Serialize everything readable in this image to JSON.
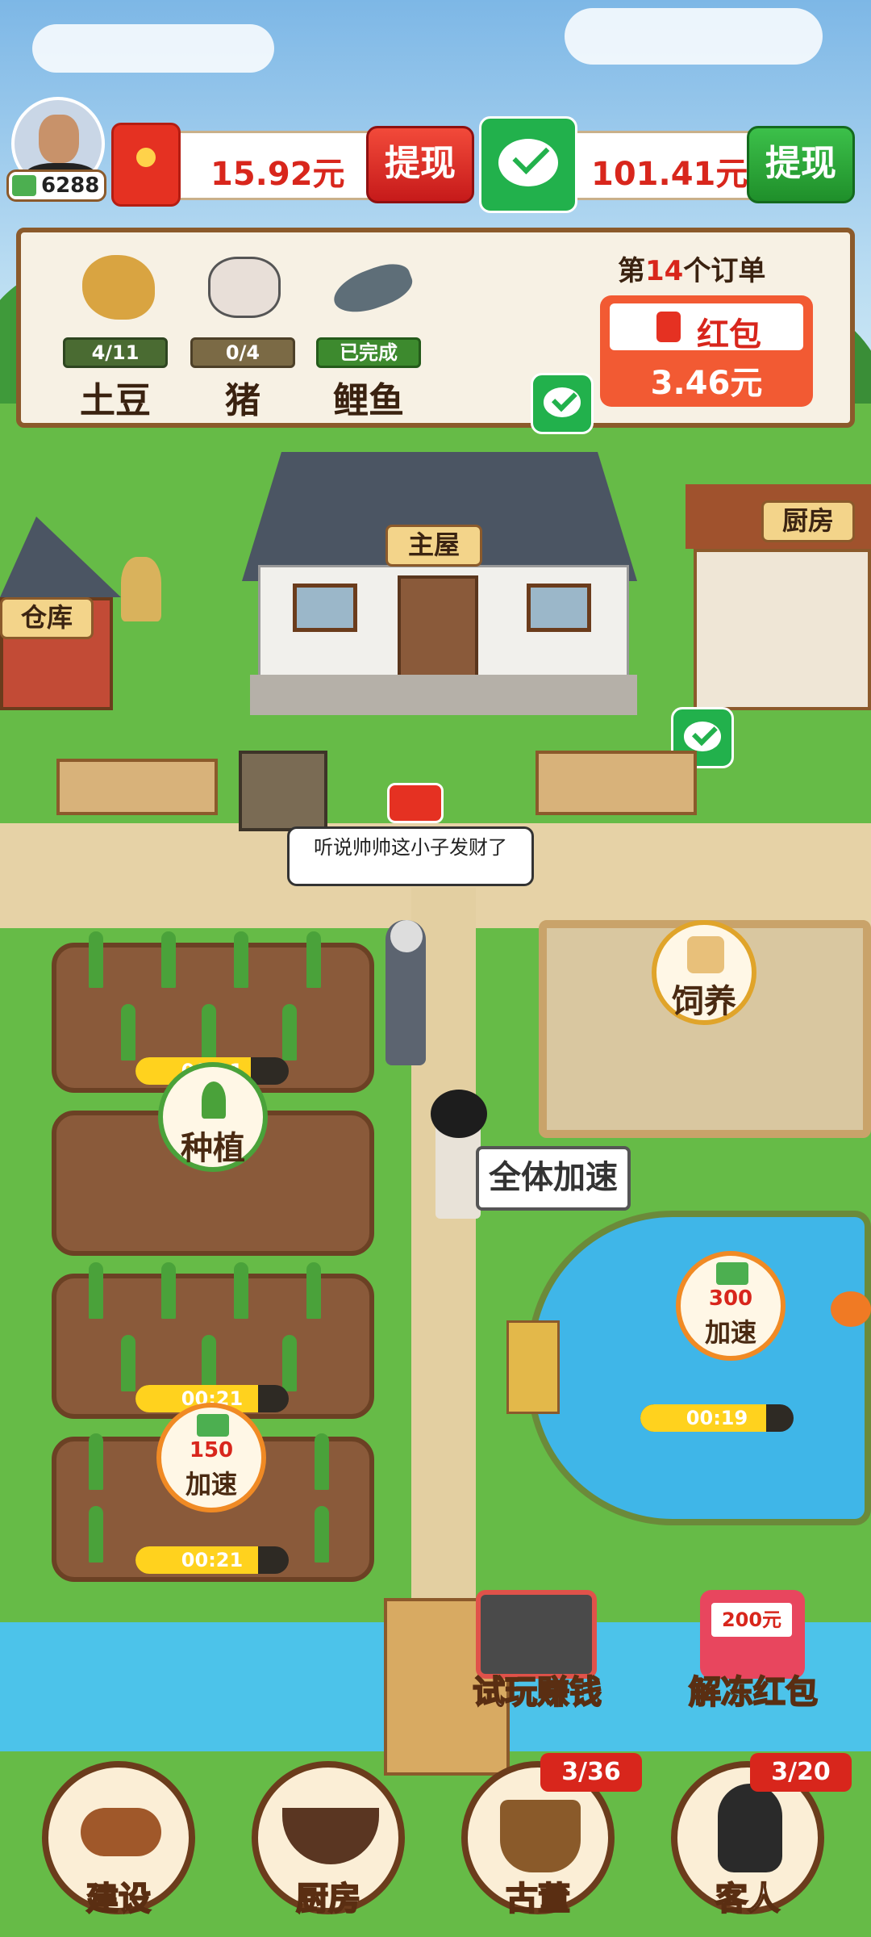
{
  "player": {
    "coins": "6288"
  },
  "wallet": [
    {
      "amount": "15.92元",
      "button": "提现"
    },
    {
      "amount": "101.41元",
      "button": "提现"
    }
  ],
  "order": {
    "title_prefix": "第",
    "number": "14",
    "title_suffix": "个订单",
    "items": [
      {
        "progress": "4/11",
        "name": "土豆",
        "icon": "potato-icon"
      },
      {
        "progress": "0/4",
        "name": "猪",
        "icon": "pig-icon"
      },
      {
        "progress": "已完成",
        "name": "鲤鱼",
        "icon": "carp-icon"
      }
    ],
    "reward_label": "红包",
    "reward_amount": "3.46元"
  },
  "buildings": {
    "main_house": "主屋",
    "warehouse": "仓库",
    "kitchen": "厨房"
  },
  "speech": "听说帅帅这小子发财了",
  "fields": [
    {
      "timer": "00:21",
      "progress": 0.75
    },
    {
      "action": "种植"
    },
    {
      "timer": "00:21",
      "progress": 0.8
    },
    {
      "timer": "00:21",
      "progress": 0.8,
      "boost_cost": "150",
      "boost_label": "加速"
    }
  ],
  "pen": {
    "action": "饲养"
  },
  "speed_all": "全体加速",
  "pond": {
    "boost_cost": "300",
    "boost_label": "加速",
    "timer": "00:19",
    "progress": 0.82
  },
  "promos": {
    "play_earn": "试玩赚钱",
    "unfreeze": "解冻红包",
    "unfreeze_amount": "200元"
  },
  "bottom_nav": [
    {
      "label": "建设",
      "icon": "axe-log-icon"
    },
    {
      "label": "厨房",
      "icon": "hotpot-icon"
    },
    {
      "label": "古董",
      "icon": "bronze-ding-icon",
      "badge": "3/36"
    },
    {
      "label": "客人",
      "icon": "guest-icon",
      "badge": "3/20"
    }
  ],
  "colors": {
    "accent_red": "#d8261c",
    "wechat_green": "#22b14c",
    "wood": "#6b3c1c"
  }
}
